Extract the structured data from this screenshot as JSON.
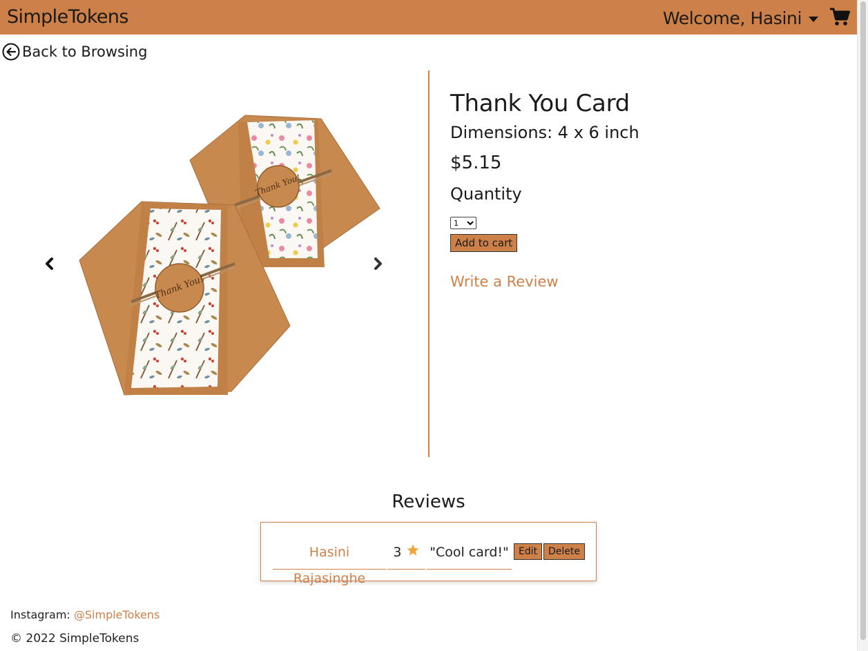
{
  "header": {
    "brand": "SimpleTokens",
    "welcome": "Welcome, Hasini"
  },
  "back_link": "Back to Browsing",
  "product": {
    "title": "Thank You Card",
    "dimensions": "Dimensions: 4 x 6 inch",
    "price": "$5.15",
    "quantity_label": "Quantity",
    "quantity_value": "1",
    "add_to_cart": "Add to cart",
    "write_review": "Write a Review",
    "card_text_1": "Thank You!",
    "card_text_2": "Thank You!"
  },
  "reviews": {
    "title": "Reviews",
    "items": [
      {
        "reviewer": "Hasini Rajasinghe",
        "rating": "3",
        "text": "\"Cool card!\"",
        "edit_label": "Edit",
        "delete_label": "Delete"
      }
    ]
  },
  "footer": {
    "instagram_label": "Instagram: ",
    "instagram_handle": "@SimpleTokens",
    "copyright": "© 2022 SimpleTokens"
  },
  "colors": {
    "accent": "#cd8048",
    "kraft": "#c8894f",
    "star": "#f2a33a"
  },
  "icons": [
    "caret-down-icon",
    "shopping-cart-icon",
    "arrow-circle-left-icon",
    "chevron-left-icon",
    "chevron-right-icon",
    "star-icon"
  ]
}
